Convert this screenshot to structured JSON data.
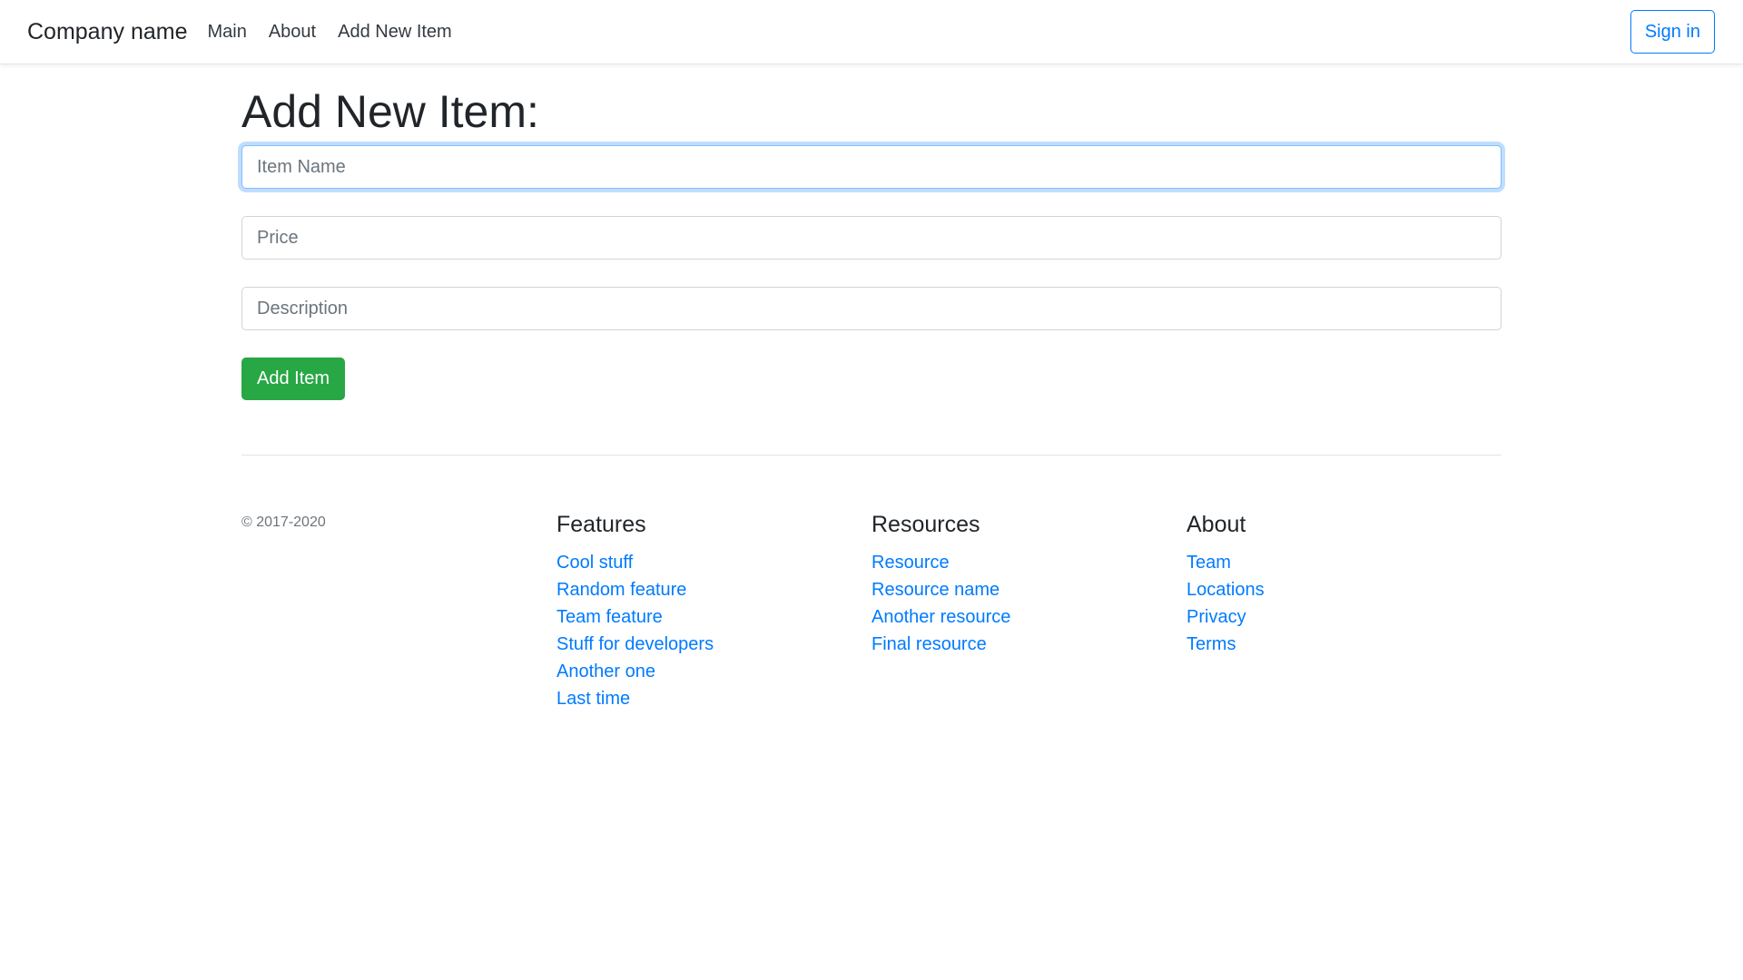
{
  "navbar": {
    "brand": "Company name",
    "links": [
      "Main",
      "About",
      "Add New Item"
    ],
    "signin_label": "Sign in"
  },
  "main": {
    "title": "Add New Item:",
    "form": {
      "item_name": {
        "value": "",
        "placeholder": "Item Name"
      },
      "price": {
        "value": "",
        "placeholder": "Price"
      },
      "description": {
        "value": "",
        "placeholder": "Description"
      },
      "submit_label": "Add Item"
    }
  },
  "footer": {
    "copyright": "© 2017-2020",
    "columns": [
      {
        "heading": "Features",
        "links": [
          "Cool stuff",
          "Random feature",
          "Team feature",
          "Stuff for developers",
          "Another one",
          "Last time"
        ]
      },
      {
        "heading": "Resources",
        "links": [
          "Resource",
          "Resource name",
          "Another resource",
          "Final resource"
        ]
      },
      {
        "heading": "About",
        "links": [
          "Team",
          "Locations",
          "Privacy",
          "Terms"
        ]
      }
    ]
  },
  "colors": {
    "primary": "#007bff",
    "success": "#28a745",
    "text": "#212529",
    "muted": "#6c757d",
    "focus_ring": "#80bdff"
  }
}
